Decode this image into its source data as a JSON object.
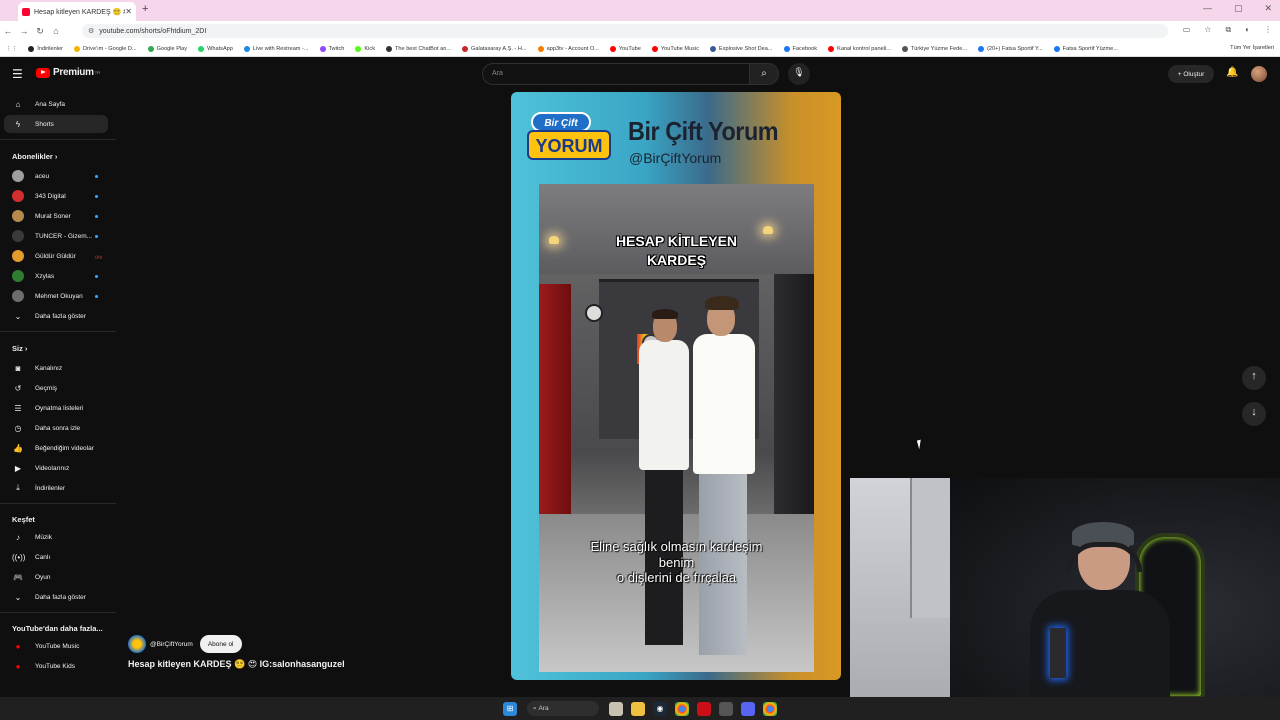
{
  "browser": {
    "tab_title": "Hesap kitleyen KARDEŞ 😵‍💫 #",
    "url": "youtube.com/shorts/oFhtdium_2DI",
    "bookmarks": [
      "İndirilenler",
      "Drive'ım - Google D...",
      "Google Play",
      "WhatsApp",
      "Live with Restream -...",
      "Twitch",
      "Kick",
      "The best ChatBot an...",
      "Galatasaray A.Ş. - H...",
      "app3tv - Account O...",
      "YouTube",
      "YouTube Music",
      "Explosive Shot Dea...",
      "Facebook",
      "Kanal kontrol paneli...",
      "Türkiye Yüzme Fede...",
      "(20+) Fatsa Sportif Y...",
      "Fatsa Sportif Yüzme..."
    ],
    "all_bookmarks": "Tüm Yer İşaretleri"
  },
  "masthead": {
    "logo_text": "Premium",
    "logo_sup": "TR",
    "search_placeholder": "Ara",
    "create_label": "Oluştur"
  },
  "sidebar": {
    "main": [
      {
        "label": "Ana Sayfa",
        "icon": "home-icon"
      },
      {
        "label": "Shorts",
        "icon": "shorts-icon"
      }
    ],
    "subs_header": "Abonelikler",
    "subs": [
      {
        "label": "aceu",
        "color": "#9e9e9e"
      },
      {
        "label": "343 Digital",
        "color": "#d32f2f"
      },
      {
        "label": "Murat Soner",
        "color": "#b58a4a"
      },
      {
        "label": "TUNCER - Gizem...",
        "color": "#3a3a3a"
      },
      {
        "label": "Güldür Güldür",
        "color": "#e39b2b"
      },
      {
        "label": "Xzylas",
        "color": "#2e7d32"
      },
      {
        "label": "Mehmet Okuyan",
        "color": "#6d6d6d"
      }
    ],
    "subs_more": "Daha fazla göster",
    "you_header": "Siz",
    "you": [
      {
        "label": "Kanalınız",
        "icon": "channel-icon"
      },
      {
        "label": "Geçmiş",
        "icon": "history-icon"
      },
      {
        "label": "Oynatma listeleri",
        "icon": "playlists-icon"
      },
      {
        "label": "Daha sonra izle",
        "icon": "watch-later-icon"
      },
      {
        "label": "Beğendiğim videolar",
        "icon": "liked-icon"
      },
      {
        "label": "Videolarınız",
        "icon": "your-videos-icon"
      },
      {
        "label": "İndirilenler",
        "icon": "downloads-icon"
      }
    ],
    "explore_header": "Keşfet",
    "explore": [
      {
        "label": "Müzik",
        "icon": "music-icon"
      },
      {
        "label": "Canlı",
        "icon": "live-icon"
      },
      {
        "label": "Oyun",
        "icon": "gaming-icon"
      }
    ],
    "explore_more": "Daha fazla göster",
    "more_header": "YouTube'dan daha fazla...",
    "more": [
      {
        "label": "YouTube Music"
      },
      {
        "label": "YouTube Kids"
      }
    ]
  },
  "short": {
    "brand_top": "Bir Çift",
    "brand_bottom": "YORUM",
    "channel_title": "Bir Çift Yorum",
    "channel_handle": "@BirÇiftYorum",
    "overlay_line1": "HESAP KİTLEYEN",
    "overlay_line2": "KARDEŞ",
    "caption_line1": "Eline sağlık olmasın kardeşim",
    "caption_line2": "benim",
    "caption_line3": "o dişlerini de fırçalaa"
  },
  "video_info": {
    "handle": "@BirÇiftYorum",
    "subscribe_label": "Abone ol",
    "title": "Hesap kitleyen KARDEŞ 😵‍💫 😍 IG:salonhasanguzel"
  },
  "taskbar": {
    "search_label": "Ara"
  }
}
